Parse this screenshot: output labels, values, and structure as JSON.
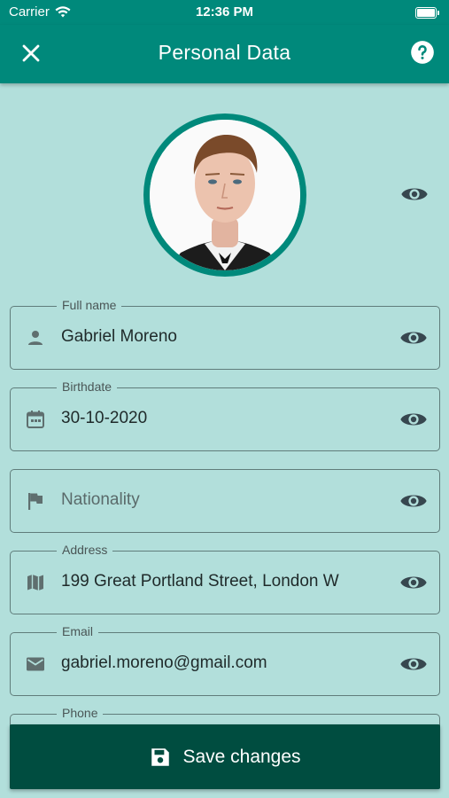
{
  "status_bar": {
    "carrier": "Carrier",
    "time": "12:36 PM"
  },
  "app_bar": {
    "title": "Personal Data"
  },
  "icons": {
    "close": "close-icon",
    "help": "help-circle-icon",
    "visibility": "eye-icon",
    "person": "person-icon",
    "calendar": "calendar-icon",
    "flag": "flag-icon",
    "map": "map-icon",
    "email": "email-icon",
    "save": "save-icon"
  },
  "colors": {
    "primary": "#00897b",
    "background": "#b2dfdb",
    "button": "#004d40"
  },
  "fields": {
    "full_name": {
      "label": "Full name",
      "value": "Gabriel Moreno"
    },
    "birthdate": {
      "label": "Birthdate",
      "value": "30-10-2020"
    },
    "nationality": {
      "label": "",
      "placeholder": "Nationality"
    },
    "address": {
      "label": "Address",
      "value": "199 Great Portland Street, London W"
    },
    "email": {
      "label": "Email",
      "value": "gabriel.moreno@gmail.com"
    },
    "phone": {
      "label": "Phone"
    }
  },
  "actions": {
    "save_label": "Save changes"
  }
}
